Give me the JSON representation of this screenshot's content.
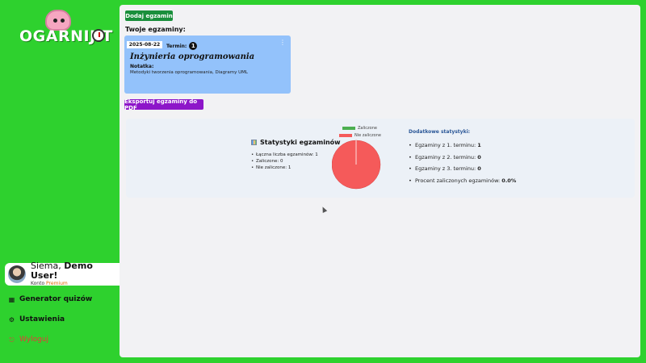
{
  "app": {
    "logo_text": "OGARNIJ.T"
  },
  "user": {
    "greeting_prefix": "Siema, ",
    "name": "Demo User!",
    "account_prefix": "Konto ",
    "account_tier": "Premium"
  },
  "nav": {
    "quiz": "Generator quizów",
    "settings": "Ustawienia",
    "logout": "Wyloguj"
  },
  "main": {
    "add_button": "Dodaj egzamin",
    "section_title": "Twoje egzaminy:",
    "export_button": "Eksportuj egzaminy do PDF"
  },
  "exams": [
    {
      "date": "2025-08-22",
      "term_label": "Termin:",
      "term_number": "1",
      "name": "Inżynieria oprogramowania",
      "notes_label": "Notatka:",
      "notes": "Metodyki tworzenia oprogramowania, Diagramy UML"
    }
  ],
  "stats": {
    "title": "Statystyki egzaminów",
    "items": [
      "Łączna liczba egzaminów: 1",
      "Zaliczone: 0",
      "Nie zaliczone: 1"
    ],
    "extra_title": "Dodatkowe statystyki:",
    "extra": [
      {
        "label": "Egzaminy z 1. terminu: ",
        "value": "1"
      },
      {
        "label": "Egzaminy z 2. terminu: ",
        "value": "0"
      },
      {
        "label": "Egzaminy z 3. terminu: ",
        "value": "0"
      },
      {
        "label": "Procent zaliczonych egzaminów: ",
        "value": "0.0%"
      }
    ]
  },
  "chart_data": {
    "type": "pie",
    "categories": [
      "Zaliczone",
      "Nie zaliczone"
    ],
    "values": [
      0,
      1
    ],
    "colors": [
      "#4caf50",
      "#f55a5a"
    ],
    "legend_position": "top"
  },
  "colors": {
    "background": "#2ed12e",
    "add_button": "#1a8f3c",
    "export_button": "#8d16c9",
    "exam_card": "#93c2fb",
    "logout_text": "#e83a3a",
    "premium": "#e06a00"
  }
}
